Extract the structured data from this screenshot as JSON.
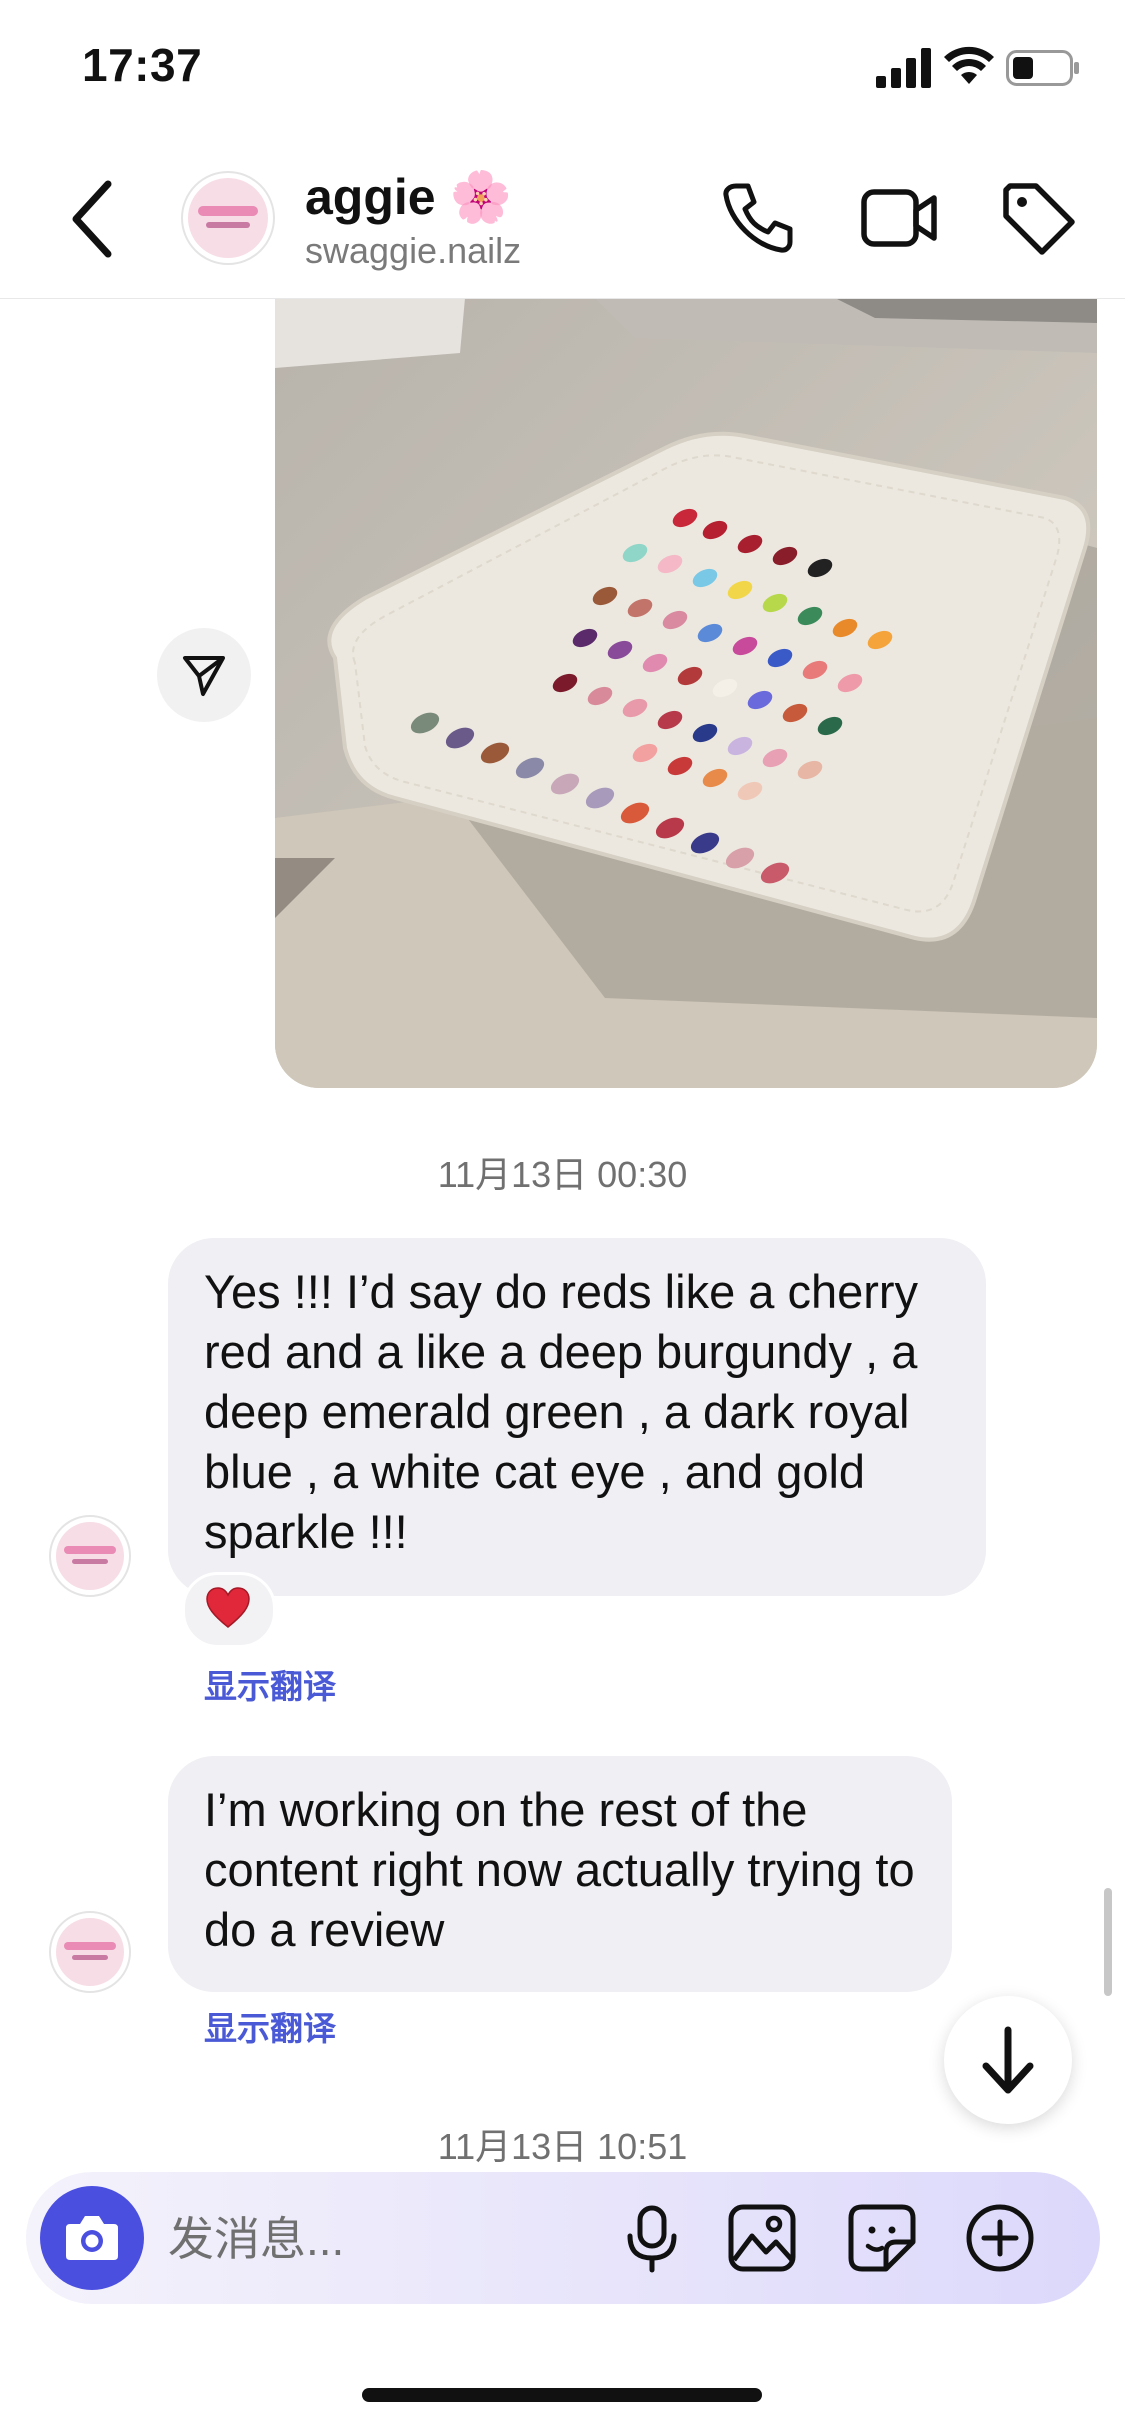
{
  "status_bar": {
    "time": "17:37"
  },
  "header": {
    "name": "aggie 🌸",
    "username": "swaggie.nailz",
    "avatar_icon": "profile-logo",
    "back_icon": "chevron-left-icon",
    "call_icon": "phone-icon",
    "video_icon": "video-camera-icon",
    "tag_icon": "tag-icon"
  },
  "photo_message": {
    "description_icon": "photo-nail-swatch-board",
    "share_icon": "paper-plane-icon"
  },
  "messages": [
    {
      "timestamp": "11月13日 00:30"
    },
    {
      "text": "Yes !!! I’d say do reds like a cherry red and a like a deep burgundy , a deep emerald green , a dark royal blue  , a white cat eye , and gold sparkle !!!",
      "reaction": "❤️",
      "translate_label": "显示翻译"
    },
    {
      "text": "I’m working on the rest of the content right now actually trying to do a review",
      "translate_label": "显示翻译"
    },
    {
      "timestamp": "11月13日 10:51"
    }
  ],
  "composer": {
    "placeholder": "发消息...",
    "camera_icon": "camera-icon",
    "mic_icon": "microphone-icon",
    "gallery_icon": "image-icon",
    "sticker_icon": "sticker-icon",
    "add_icon": "plus-circle-icon"
  },
  "colors": {
    "accent": "#4b4fe0",
    "link": "#4a5ad6",
    "bubble": "#efeff4"
  }
}
